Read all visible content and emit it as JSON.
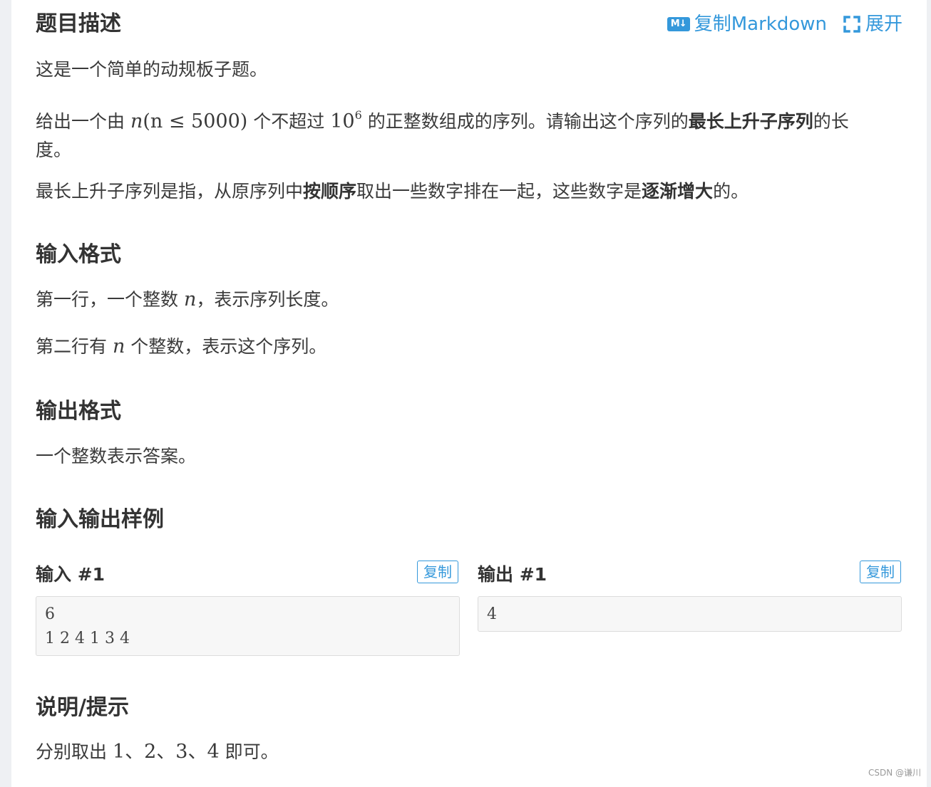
{
  "toolbar": {
    "md_icon": "M↓",
    "copy_markdown": "复制Markdown",
    "expand": "展开",
    "accent": "#3498db"
  },
  "desc": {
    "title": "题目描述",
    "p1": "这是一个简单的动规板子题。",
    "p2_a": "给出一个由 ",
    "p2_math1_n": "n",
    "p2_math1_rest": "(n ≤ 5000)",
    "p2_b": " 个不超过 ",
    "p2_math2_base": "10",
    "p2_math2_exp": "6",
    "p2_c": " 的正整数组成的序列。请输出这个序列的",
    "p2_bold": "最长上升子序列",
    "p2_d": "的长",
    "p2_e": "度。",
    "p3_a": "最长上升子序列是指，从原序列中",
    "p3_bold1": "按顺序",
    "p3_b": "取出一些数字排在一起，这些数字是",
    "p3_bold2": "逐渐增大",
    "p3_c": "的。"
  },
  "input_format": {
    "title": "输入格式",
    "l1_a": "第一行，一个整数 ",
    "l1_n": "n",
    "l1_b": "，表示序列长度。",
    "l2_a": "第二行有 ",
    "l2_n": "n",
    "l2_b": " 个整数，表示这个序列。"
  },
  "output_format": {
    "title": "输出格式",
    "l1": "一个整数表示答案。"
  },
  "samples": {
    "title": "输入输出样例",
    "input_label": "输入 #1",
    "output_label": "输出 #1",
    "copy": "复制",
    "input_text": "6\n1 2 4 1 3 4",
    "output_text": "4"
  },
  "hint": {
    "title": "说明/提示",
    "l1_a": "分别取出 ",
    "l1_nums": "1、2、3、4",
    "l1_b": " 即可。"
  },
  "watermark": "CSDN @谦川"
}
